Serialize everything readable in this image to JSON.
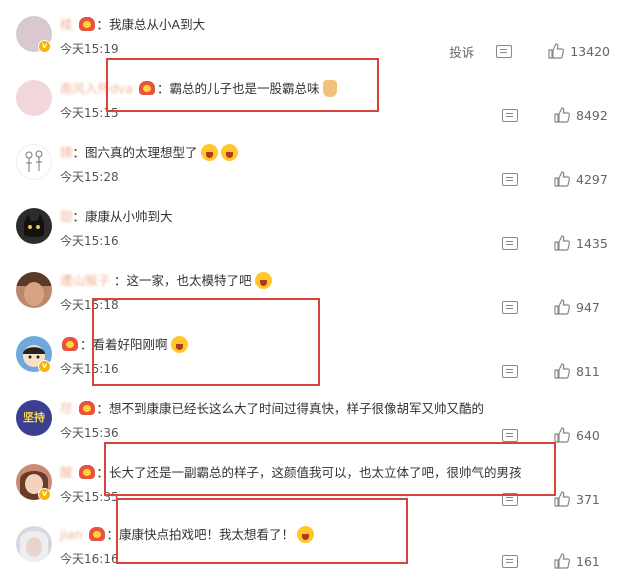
{
  "comments": [
    {
      "user": "楼",
      "text": "我康总从小A到大",
      "time": "今天15:19",
      "report": "投诉",
      "likes": "13420",
      "avatar_color": "#d9c9cf",
      "emoji": ""
    },
    {
      "user": "南风入怀dva",
      "text": "霸总的儿子也是一股霸总味",
      "time": "今天15:15",
      "report": "",
      "likes": "8492",
      "avatar_color": "#f3d6da",
      "emoji": "thumb"
    },
    {
      "user": "姨",
      "text": "图六真的太理想型了",
      "time": "今天15:28",
      "report": "",
      "likes": "4297",
      "avatar_color": "#ffffff",
      "emoji": "cry"
    },
    {
      "user": "甜",
      "text": "康康从小帅到大",
      "time": "今天15:16",
      "report": "",
      "likes": "1435",
      "avatar_color": "#2c2c2c",
      "emoji": ""
    },
    {
      "user": "遭山猴子",
      "text": "这一家，也太模特了吧",
      "time": "今天15:18",
      "report": "",
      "likes": "947",
      "avatar_color": "#b98a6a",
      "emoji": "cry"
    },
    {
      "user": "",
      "text": "看着好阳刚啊",
      "time": "今天15:16",
      "report": "",
      "likes": "811",
      "avatar_color": "#6fa8dc",
      "emoji": "cry"
    },
    {
      "user": "尽",
      "text": "想不到康康已经长这么大了时间过得真快，样子很像胡军又帅又酷的",
      "time": "今天15:36",
      "report": "",
      "likes": "640",
      "avatar_color": "#3b3f8f",
      "emoji": ""
    },
    {
      "user": "醒",
      "text": "长大了还是一副霸总的样子，这颜值我可以，也太立体了吧，很帅气的男孩",
      "time": "今天15:35",
      "report": "",
      "likes": "371",
      "avatar_color": "#c98b74",
      "emoji": ""
    },
    {
      "user": "jian",
      "text": "康康快点拍戏吧！我太想看了！",
      "time": "今天16:16",
      "report": "",
      "likes": "161",
      "avatar_color": "#d8d8de",
      "emoji": "cry"
    }
  ],
  "avatar_text_7": "坚持",
  "colors": {
    "username": "#eb7340",
    "highlight_box": "#d9433d",
    "text": "#333333",
    "muted": "#666666"
  }
}
